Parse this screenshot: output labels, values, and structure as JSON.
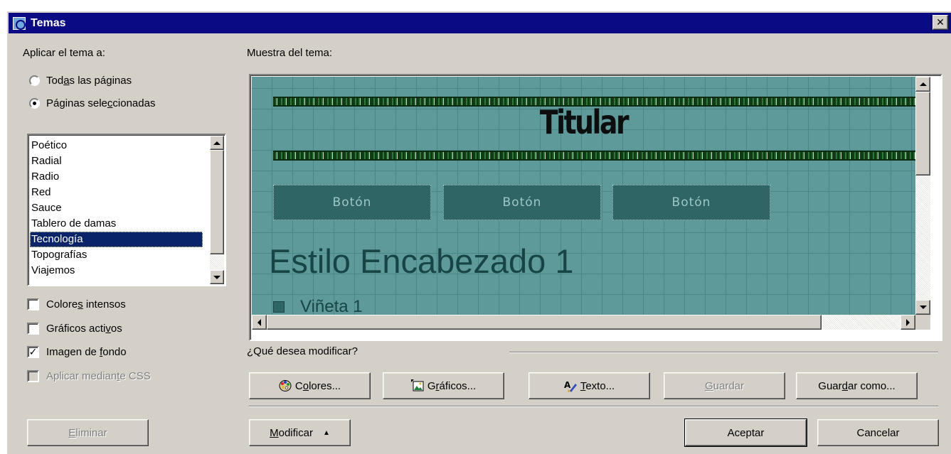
{
  "window": {
    "title": "Temas",
    "close_glyph": "✕"
  },
  "apply_section": {
    "label": "Aplicar el tema a:",
    "radio_all": {
      "pre": "Tod",
      "u": "a",
      "post": "s las páginas",
      "checked": false
    },
    "radio_selected": {
      "pre": "Páginas sele",
      "u": "c",
      "post": "cionadas",
      "checked": true
    }
  },
  "theme_list": {
    "items": [
      "Poético",
      "Radial",
      "Radio",
      "Red",
      "Sauce",
      "Tablero de damas",
      "Tecnología",
      "Topografías",
      "Viajemos"
    ],
    "selected": "Tecnología"
  },
  "options": {
    "vivid": {
      "pre": "Colore",
      "u": "s",
      "post": " intensos",
      "checked": false
    },
    "active": {
      "pre": "Gráficos acti",
      "u": "v",
      "post": "os",
      "checked": false
    },
    "background": {
      "pre": "Imagen de ",
      "u": "f",
      "post": "ondo",
      "checked": true
    },
    "css": {
      "pre": "Aplicar median",
      "u": "t",
      "post": "e CSS",
      "checked": false,
      "disabled": true
    }
  },
  "preview": {
    "label": "Muestra del tema:",
    "banner_title": "Titular",
    "nav_buttons": [
      "Botón",
      "Botón",
      "Botón"
    ],
    "heading": "Estilo Encabezado 1",
    "bullet": "Viñeta 1",
    "colors": {
      "background": "#5f9a9a",
      "button": "#2f6565",
      "heading": "#174545"
    }
  },
  "modify_section": {
    "label": "¿Qué desea modificar?",
    "colors_btn": {
      "pre": "C",
      "u": "o",
      "post": "lores...",
      "icon": "palette-icon"
    },
    "graphics_btn": {
      "pre": "G",
      "u": "r",
      "post": "áficos...",
      "icon": "picture-icon"
    },
    "text_btn": {
      "pre": "",
      "u": "T",
      "post": "exto...",
      "icon": "text-brush-icon"
    },
    "save_btn": {
      "pre": "",
      "u": "G",
      "post": "uardar"
    },
    "save_as_btn": {
      "pre": "Guar",
      "u": "d",
      "post": "ar como..."
    }
  },
  "footer": {
    "delete_btn": {
      "pre": "",
      "u": "E",
      "post": "liminar"
    },
    "modify_btn": {
      "pre": "",
      "u": "M",
      "post": "odificar",
      "arrow": "▲"
    },
    "ok_btn": "Aceptar",
    "cancel_btn": "Cancelar"
  }
}
